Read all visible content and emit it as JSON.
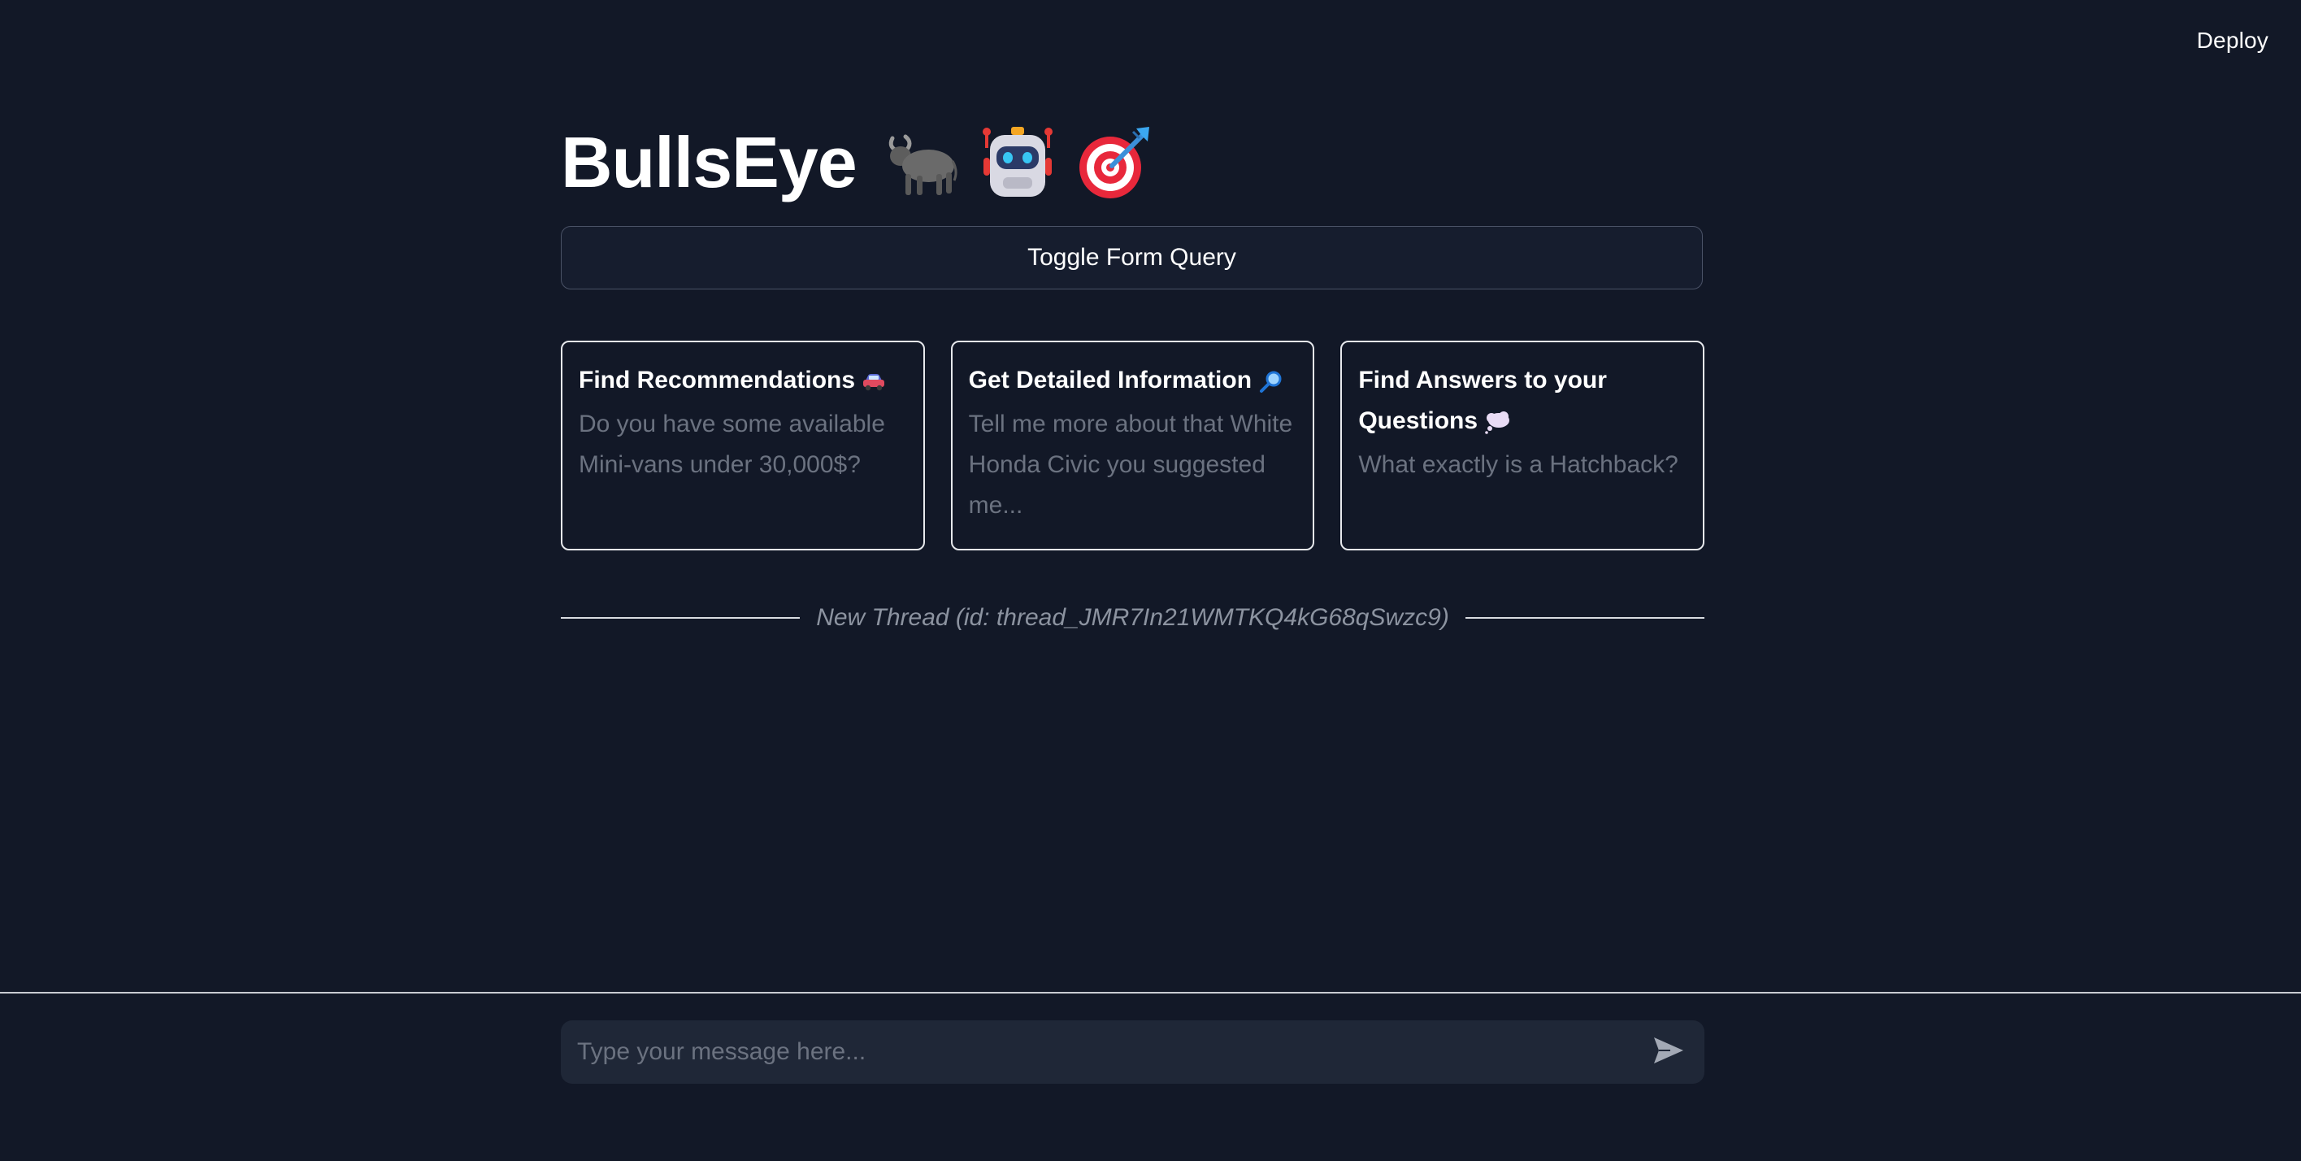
{
  "header": {
    "deploy_label": "Deploy"
  },
  "title": {
    "text": "BullsEye",
    "icons": [
      "bull-icon",
      "robot-icon",
      "bullseye-target-icon"
    ]
  },
  "toggle": {
    "label": "Toggle Form Query"
  },
  "cards": [
    {
      "title": "Find Recommendations",
      "icon": "car-icon",
      "body": "Do you have some available Mini-vans under 30,000$?"
    },
    {
      "title": "Get Detailed Information",
      "icon": "magnifier-icon",
      "body": "Tell me more about that White Honda Civic you suggested me..."
    },
    {
      "title": "Find Answers to your Questions",
      "icon": "thought-bubble-icon",
      "body": "What exactly is a Hatchback?"
    }
  ],
  "thread": {
    "label": "New Thread (id: thread_JMR7In21WMTKQ4kG68qSwzc9)"
  },
  "chat": {
    "placeholder": "Type your message here...",
    "value": "",
    "send_icon": "send-icon"
  },
  "colors": {
    "background": "#121827",
    "input_background": "#1f2737",
    "muted_text": "#6b7280",
    "card_border": "#e6e8ec"
  }
}
